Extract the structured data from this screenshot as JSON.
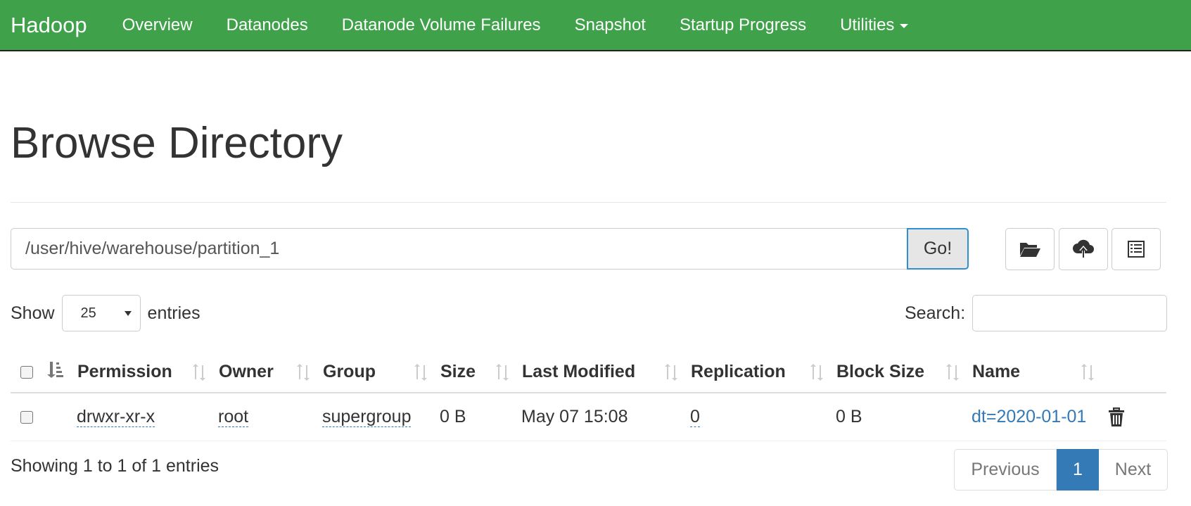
{
  "navbar": {
    "brand": "Hadoop",
    "items": [
      "Overview",
      "Datanodes",
      "Datanode Volume Failures",
      "Snapshot",
      "Startup Progress"
    ],
    "utilities_label": "Utilities"
  },
  "page": {
    "title": "Browse Directory"
  },
  "path_bar": {
    "value": "/user/hive/warehouse/partition_1",
    "go_label": "Go!"
  },
  "toolbar": {
    "icons": [
      "folder-open-icon",
      "cloud-upload-icon",
      "list-icon"
    ]
  },
  "table_controls": {
    "show_label": "Show",
    "entries_label": "entries",
    "page_length": "25",
    "search_label": "Search:",
    "search_value": ""
  },
  "table": {
    "columns": [
      "Permission",
      "Owner",
      "Group",
      "Size",
      "Last Modified",
      "Replication",
      "Block Size",
      "Name"
    ],
    "rows": [
      {
        "permission": "drwxr-xr-x",
        "owner": "root",
        "group": "supergroup",
        "size": "0 B",
        "last_modified": "May 07 15:08",
        "replication": "0",
        "block_size": "0 B",
        "name": "dt=2020-01-01"
      }
    ]
  },
  "footer": {
    "info": "Showing 1 to 1 of 1 entries",
    "previous_label": "Previous",
    "current_page": "1",
    "next_label": "Next"
  },
  "colors": {
    "navbar": "#3fa14a",
    "link": "#337ab7",
    "active_page": "#337ab7"
  }
}
